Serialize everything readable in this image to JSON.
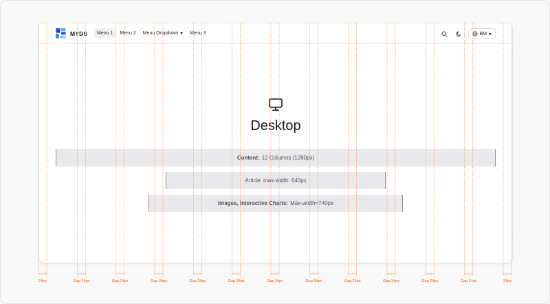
{
  "navbar": {
    "brand": "MYDS",
    "menu": [
      {
        "label": "Menu 1",
        "active": true,
        "dropdown": false
      },
      {
        "label": "Menu 2",
        "active": false,
        "dropdown": false
      },
      {
        "label": "Menu Dropdown",
        "active": false,
        "dropdown": true
      },
      {
        "label": "Menu 3",
        "active": false,
        "dropdown": false
      }
    ],
    "search_icon": "search-icon",
    "theme_icon": "moon-icon",
    "language": "BM",
    "language_icon": "globe-icon"
  },
  "hero": {
    "icon": "monitor-icon",
    "title": "Desktop"
  },
  "bars": {
    "content": {
      "bold": "Content:",
      "text": "12 Columns (1280px)"
    },
    "article": {
      "text": "Article: max-width: 640px"
    },
    "images": {
      "bold": "Images, Interactive Charts:",
      "text": "Max-width=740px"
    }
  },
  "grid": {
    "margin_label": "24px",
    "gap_label": "Gap 24px",
    "columns": 12
  },
  "colors": {
    "guide": "#f59e63",
    "label": "#ea580c",
    "bar_fill": "#e9e9ec",
    "brand_blue": "#2563eb"
  }
}
